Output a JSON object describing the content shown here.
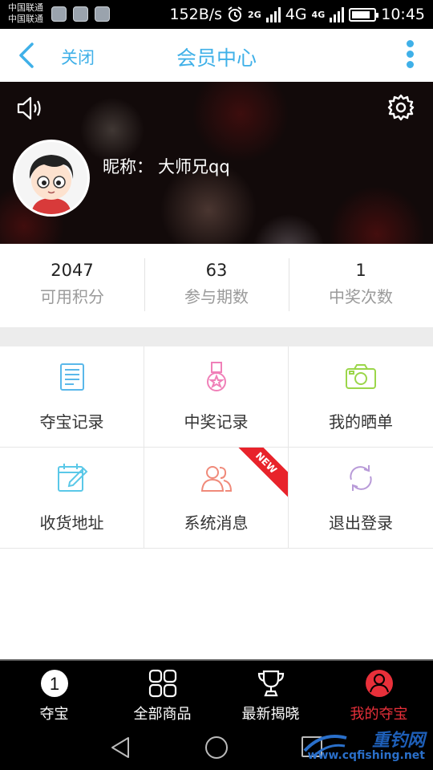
{
  "status_bar": {
    "carrier_1": "中国联通",
    "carrier_2": "中国联通",
    "speed": "152B/s",
    "net_small": "2G",
    "net_big": "4G",
    "net_tiny": "4G",
    "time": "10:45"
  },
  "header": {
    "close_label": "关闭",
    "title": "会员中心"
  },
  "profile": {
    "nick_label": "昵称：",
    "nick_value": "大师兄qq"
  },
  "stats": [
    {
      "value": "2047",
      "label": "可用积分"
    },
    {
      "value": "63",
      "label": "参与期数"
    },
    {
      "value": "1",
      "label": "中奖次数"
    }
  ],
  "menu": [
    {
      "label": "夺宝记录",
      "icon": "document-icon",
      "color": "#5ab8ea"
    },
    {
      "label": "中奖记录",
      "icon": "medal-icon",
      "color": "#f080b8"
    },
    {
      "label": "我的晒单",
      "icon": "camera-icon",
      "color": "#9bd64a"
    },
    {
      "label": "收货地址",
      "icon": "calendar-edit-icon",
      "color": "#5ac8e8"
    },
    {
      "label": "系统消息",
      "icon": "users-icon",
      "color": "#f08a7a",
      "badge": "NEW"
    },
    {
      "label": "退出登录",
      "icon": "refresh-icon",
      "color": "#b89ad8"
    }
  ],
  "tabs": [
    {
      "label": "夺宝",
      "icon_text": "1",
      "icon": "number-one-icon",
      "active": false
    },
    {
      "label": "全部商品",
      "icon": "grid-icon",
      "active": false
    },
    {
      "label": "最新揭晓",
      "icon": "trophy-icon",
      "active": false
    },
    {
      "label": "我的夺宝",
      "icon": "user-circle-icon",
      "active": true
    }
  ],
  "watermark": {
    "text": "重钓网",
    "url": "www.cqfishing.net"
  },
  "colors": {
    "accent": "#3fb0e8",
    "active_tab": "#e8303a",
    "new_badge": "#e8232b"
  }
}
